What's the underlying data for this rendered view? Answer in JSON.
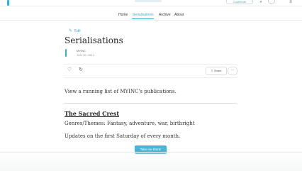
{
  "header": {
    "contribute_label": "Contribute",
    "icons": [
      "search-icon",
      "user-icon",
      "menu-icon"
    ]
  },
  "nav": {
    "items": [
      {
        "label": "Home",
        "active": false
      },
      {
        "label": "Serialisations",
        "active": true
      },
      {
        "label": "Archive",
        "active": false
      },
      {
        "label": "About",
        "active": false
      }
    ]
  },
  "post": {
    "edit_label": "Edit",
    "title": "Serialisations",
    "author": "MYINC",
    "date": "JUN 30, 2021",
    "share_label": "Share",
    "more_label": "···",
    "intro": "View a running list of MYINC's publications.",
    "work": {
      "title": "The Sacred Crest",
      "genres": "Genres/Themes: Fantasy, adventure, war, birthright",
      "schedule": "Updates on the first Saturday of every month.",
      "cta": "Take me there!"
    }
  },
  "colors": {
    "accent": "#3ab0d0",
    "button": "#4ab4d6"
  }
}
